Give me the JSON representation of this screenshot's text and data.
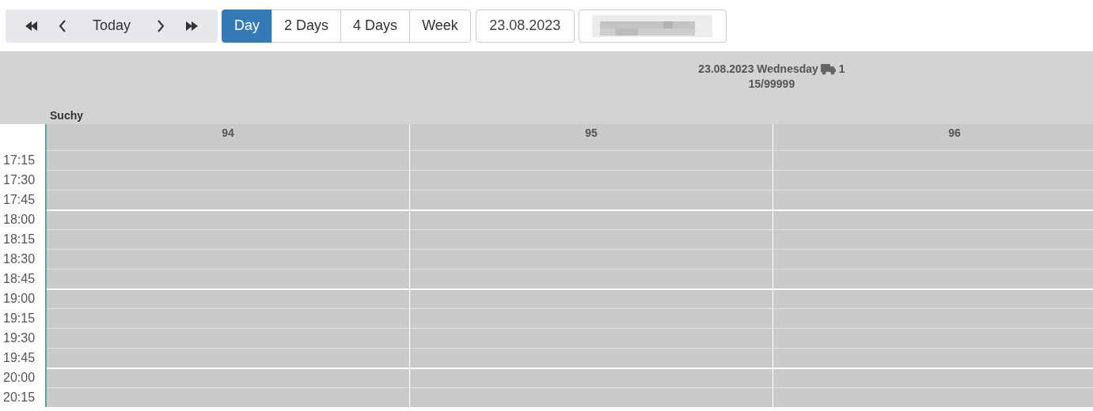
{
  "navigation": [
    {
      "kind": "first"
    },
    {
      "kind": "prev"
    },
    {
      "kind": "today",
      "label": "Today"
    },
    {
      "kind": "next"
    },
    {
      "kind": "last"
    }
  ],
  "views": [
    {
      "label": "Day",
      "selected": true
    },
    {
      "label": "2 Days",
      "selected": false
    },
    {
      "label": "4 Days",
      "selected": false
    },
    {
      "label": "Week",
      "selected": false
    }
  ],
  "date_field": {
    "value": "23.08.2023"
  },
  "day_header": {
    "date": "23.08.2023 Wednesday",
    "truck_count": "1",
    "capacity": "15/99999"
  },
  "resource": "Suchy",
  "columns": [
    "94",
    "95",
    "96"
  ],
  "times": [
    "17:15",
    "17:30",
    "17:45",
    "18:00",
    "18:15",
    "18:30",
    "18:45",
    "19:00",
    "19:15",
    "19:30",
    "19:45",
    "20:00",
    "20:15"
  ]
}
